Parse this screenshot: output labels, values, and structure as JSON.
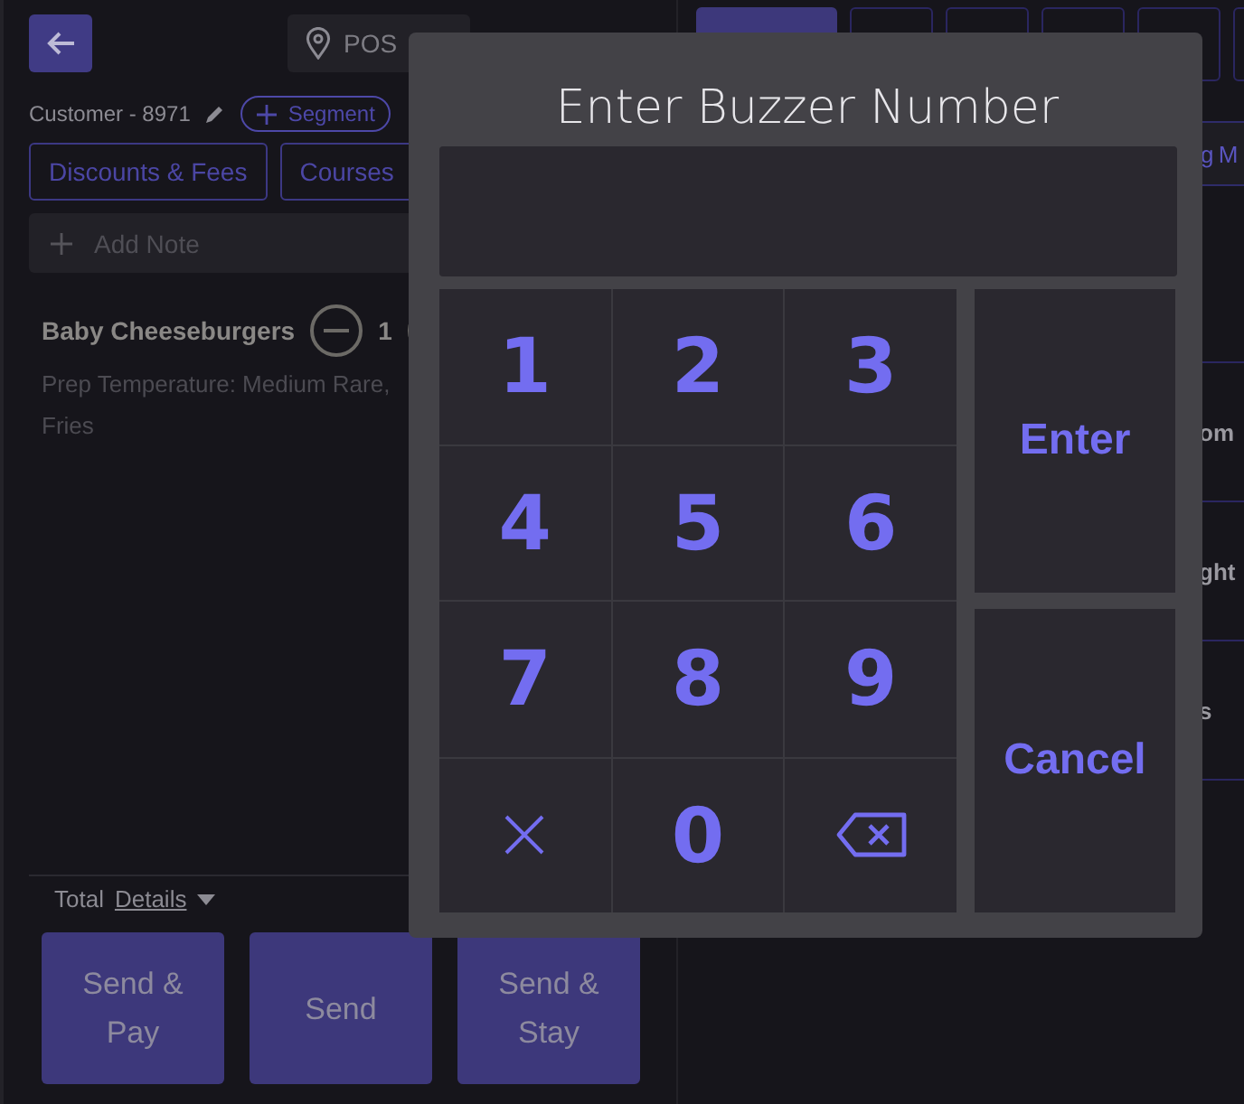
{
  "order_panel": {
    "location": "POS",
    "customer": "Customer - 8971",
    "segment_button": "Segment",
    "action_buttons": [
      "Discounts & Fees",
      "Courses"
    ],
    "add_note": "Add Note",
    "items": [
      {
        "name": "Baby Cheeseburgers",
        "quantity": "1",
        "modifiers": "Prep Temperature: Medium Rare, Fries"
      }
    ],
    "total_label": "Total",
    "details_link": "Details",
    "send_buttons": [
      "Send & Pay",
      "Send",
      "Send & Stay"
    ]
  },
  "menu_panel": {
    "tabs": [
      {
        "selected": true
      },
      {
        "selected": false
      },
      {
        "selected": false
      },
      {
        "selected": false
      },
      {
        "selected": false
      },
      {
        "selected": false
      }
    ],
    "category_bar": "g M",
    "rows": [
      "",
      "om",
      "ght",
      "s"
    ]
  },
  "dialog": {
    "title": "Enter Buzzer Number",
    "keys": [
      {
        "kind": "digit",
        "label": "1"
      },
      {
        "kind": "digit",
        "label": "2"
      },
      {
        "kind": "digit",
        "label": "3"
      },
      {
        "kind": "digit",
        "label": "4"
      },
      {
        "kind": "digit",
        "label": "5"
      },
      {
        "kind": "digit",
        "label": "6"
      },
      {
        "kind": "digit",
        "label": "7"
      },
      {
        "kind": "digit",
        "label": "8"
      },
      {
        "kind": "digit",
        "label": "9"
      },
      {
        "kind": "clear"
      },
      {
        "kind": "digit",
        "label": "0"
      },
      {
        "kind": "backspace"
      }
    ],
    "enter_button": "Enter",
    "cancel_button": "Cancel"
  }
}
